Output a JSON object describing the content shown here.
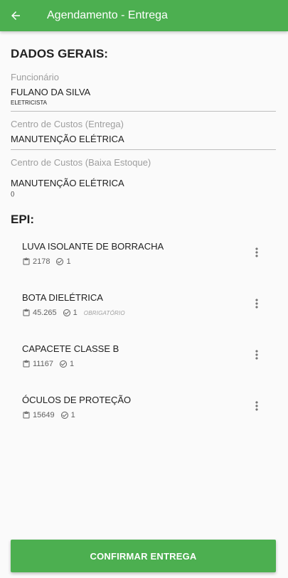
{
  "app_bar": {
    "title": "Agendamento - Entrega",
    "back_icon": "arrow-back-icon",
    "color": "#4caf50"
  },
  "general": {
    "section_title": "DADOS GERAIS:",
    "employee": {
      "label": "Funcionário",
      "name": "FULANO DA SILVA",
      "role": "ELETRICISTA"
    },
    "cost_center_delivery": {
      "label": "Centro de Custos (Entrega)",
      "value": "MANUTENÇÃO ELÉTRICA"
    },
    "cost_center_stock": {
      "label": "Centro de Custos (Baixa Estoque)",
      "value": "MANUTENÇÃO ELÉTRICA",
      "sub": "()"
    }
  },
  "epi": {
    "section_title": "EPI:",
    "items": [
      {
        "name": "LUVA ISOLANTE DE BORRACHA",
        "code": "2178",
        "quantity": "1",
        "tag": ""
      },
      {
        "name": "BOTA DIELÉTRICA",
        "code": "45.265",
        "quantity": "1",
        "tag": "OBRIGATÓRIO"
      },
      {
        "name": "CAPACETE CLASSE B",
        "code": "11167",
        "quantity": "1",
        "tag": ""
      },
      {
        "name": "ÓCULOS DE PROTEÇÃO",
        "code": "15649",
        "quantity": "1",
        "tag": ""
      }
    ]
  },
  "confirm_button": {
    "label": "CONFIRMAR ENTREGA"
  }
}
